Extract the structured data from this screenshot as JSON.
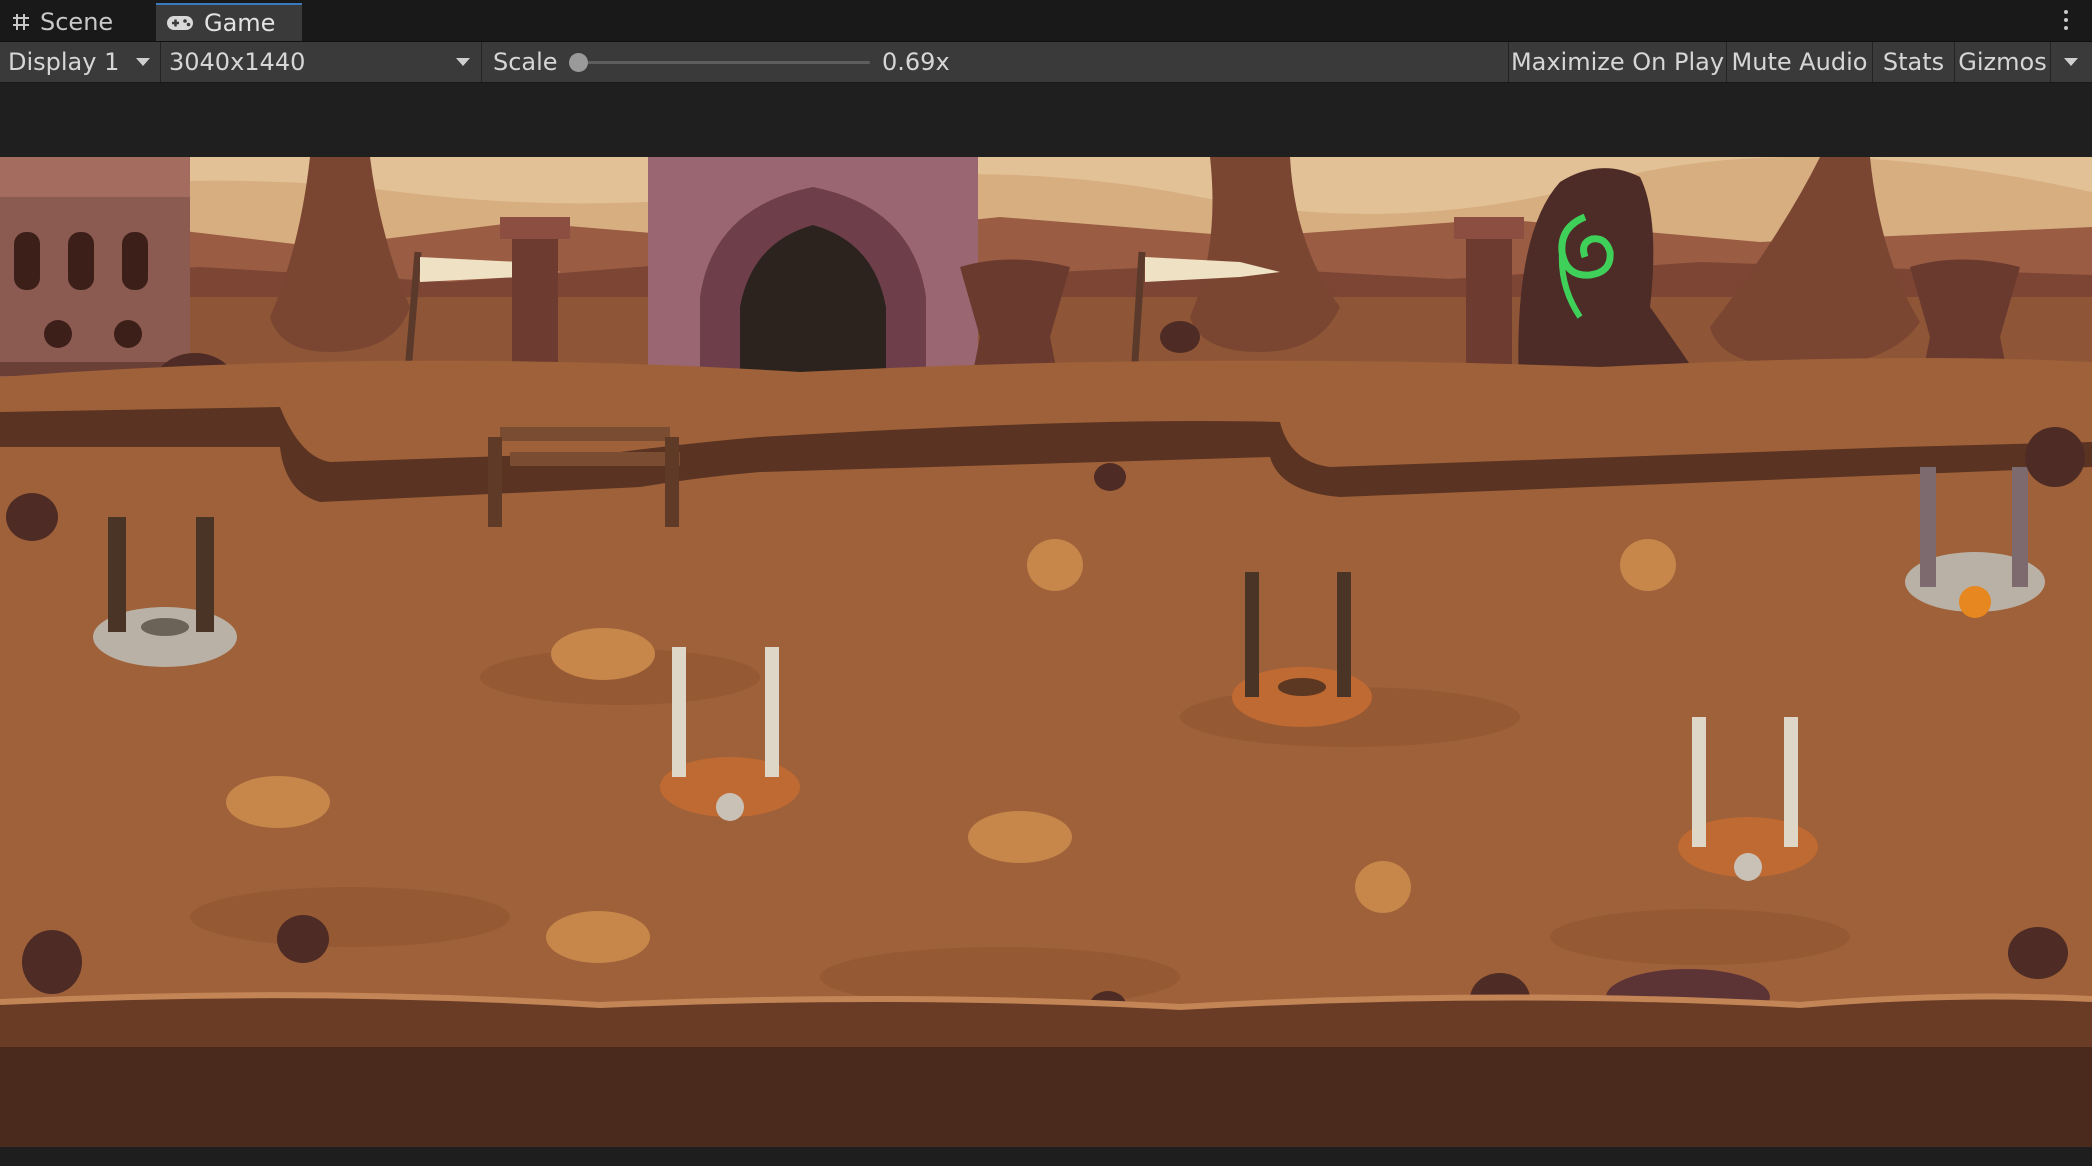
{
  "tabs": [
    {
      "label": "Scene",
      "icon": "grid-icon",
      "active": false
    },
    {
      "label": "Game",
      "icon": "gamepad-icon",
      "active": true
    }
  ],
  "toolbar": {
    "display": "Display 1",
    "resolution": "3040x1440",
    "scale_label": "Scale",
    "scale_value": "0.69x",
    "scale_level": 0.0,
    "maximize": "Maximize On Play",
    "mute": "Mute Audio",
    "stats": "Stats",
    "gizmos": "Gizmos"
  },
  "colors": {
    "editor_bg": "#1e1e1e",
    "toolbar_bg": "#3a3a3a",
    "active_tab_accent": "#3a79bb",
    "sky": "#d9b48a",
    "ground": "#9a5f3a",
    "cliff": "#5a3322"
  },
  "game_view": {
    "scene": "desert battlefield",
    "elements": [
      "castle-gate",
      "ruined-building",
      "rock-spires",
      "flags",
      "green-rune-monolith",
      "urns",
      "wooden-bridge",
      "tower-build-plots",
      "ore-piles",
      "rocks",
      "front-cliff"
    ]
  }
}
